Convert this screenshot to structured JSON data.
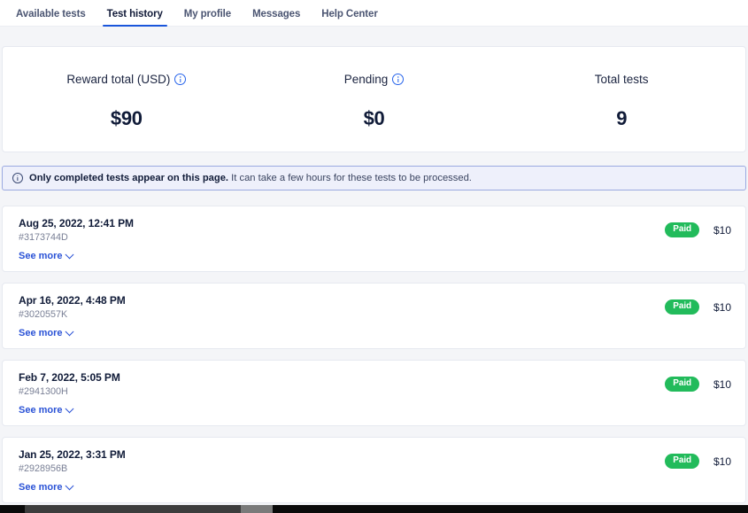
{
  "nav": {
    "tabs": [
      {
        "label": "Available tests",
        "active": false
      },
      {
        "label": "Test history",
        "active": true
      },
      {
        "label": "My profile",
        "active": false
      },
      {
        "label": "Messages",
        "active": false
      },
      {
        "label": "Help Center",
        "active": false
      }
    ]
  },
  "stats": [
    {
      "label": "Reward total (USD)",
      "value": "$90",
      "has_info": true
    },
    {
      "label": "Pending",
      "value": "$0",
      "has_info": true
    },
    {
      "label": "Total tests",
      "value": "9",
      "has_info": false
    }
  ],
  "notice": {
    "icon": "info-circle-icon",
    "strong": "Only completed tests appear on this page.",
    "rest": " It can take a few hours for these tests to be processed."
  },
  "history": {
    "see_more_label": "See more",
    "items": [
      {
        "date": "Aug 25, 2022, 12:41 PM",
        "id": "#3173744D",
        "status": "Paid",
        "amount": "$10"
      },
      {
        "date": "Apr 16, 2022, 4:48 PM",
        "id": "#3020557K",
        "status": "Paid",
        "amount": "$10"
      },
      {
        "date": "Feb 7, 2022, 5:05 PM",
        "id": "#2941300H",
        "status": "Paid",
        "amount": "$10"
      },
      {
        "date": "Jan 25, 2022, 3:31 PM",
        "id": "#2928956B",
        "status": "Paid",
        "amount": "$10"
      }
    ]
  },
  "colors": {
    "accent_blue": "#1a56db",
    "link_blue": "#2a52d6",
    "badge_green": "#22bb5b",
    "notice_bg": "#eef0fb",
    "notice_border": "#9aa9e0",
    "page_bg": "#f4f5f8"
  }
}
